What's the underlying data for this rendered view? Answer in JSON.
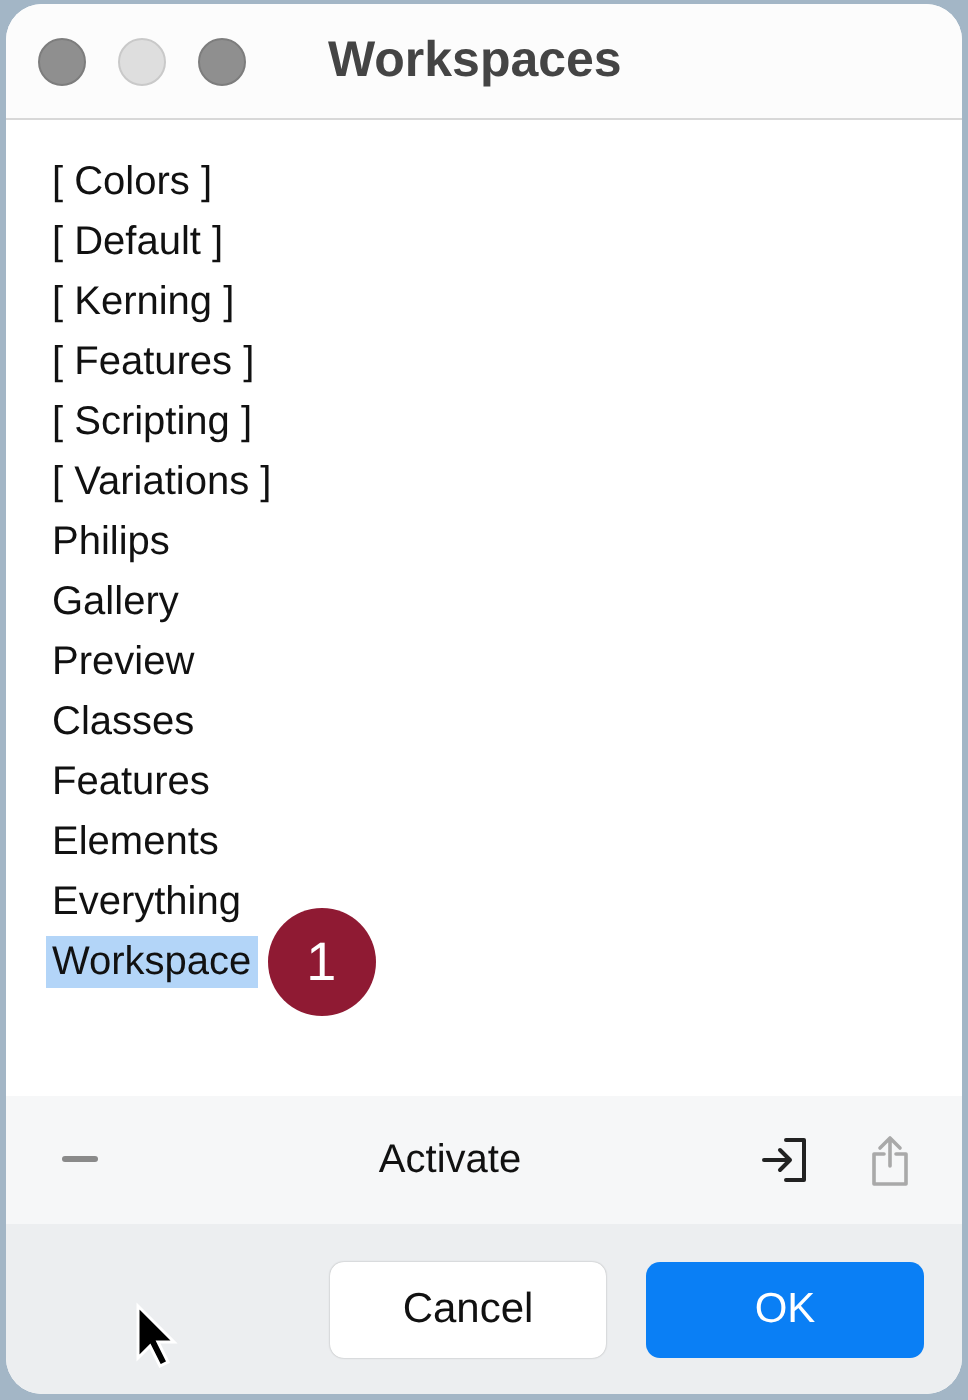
{
  "window": {
    "title": "Workspaces"
  },
  "workspaces": [
    {
      "label": "[ Colors ]",
      "selected": false
    },
    {
      "label": "[ Default ]",
      "selected": false
    },
    {
      "label": "[ Kerning ]",
      "selected": false
    },
    {
      "label": "[ Features ]",
      "selected": false
    },
    {
      "label": "[ Scripting ]",
      "selected": false
    },
    {
      "label": "[ Variations ]",
      "selected": false
    },
    {
      "label": "Philips",
      "selected": false
    },
    {
      "label": "Gallery",
      "selected": false
    },
    {
      "label": "Preview",
      "selected": false
    },
    {
      "label": "Classes",
      "selected": false
    },
    {
      "label": "Features",
      "selected": false
    },
    {
      "label": "Elements",
      "selected": false
    },
    {
      "label": "Everything",
      "selected": false
    },
    {
      "label": "Workspace",
      "selected": true,
      "callout": "1"
    }
  ],
  "toolbar": {
    "action": "Activate"
  },
  "buttons": {
    "cancel": "Cancel",
    "ok": "OK"
  }
}
